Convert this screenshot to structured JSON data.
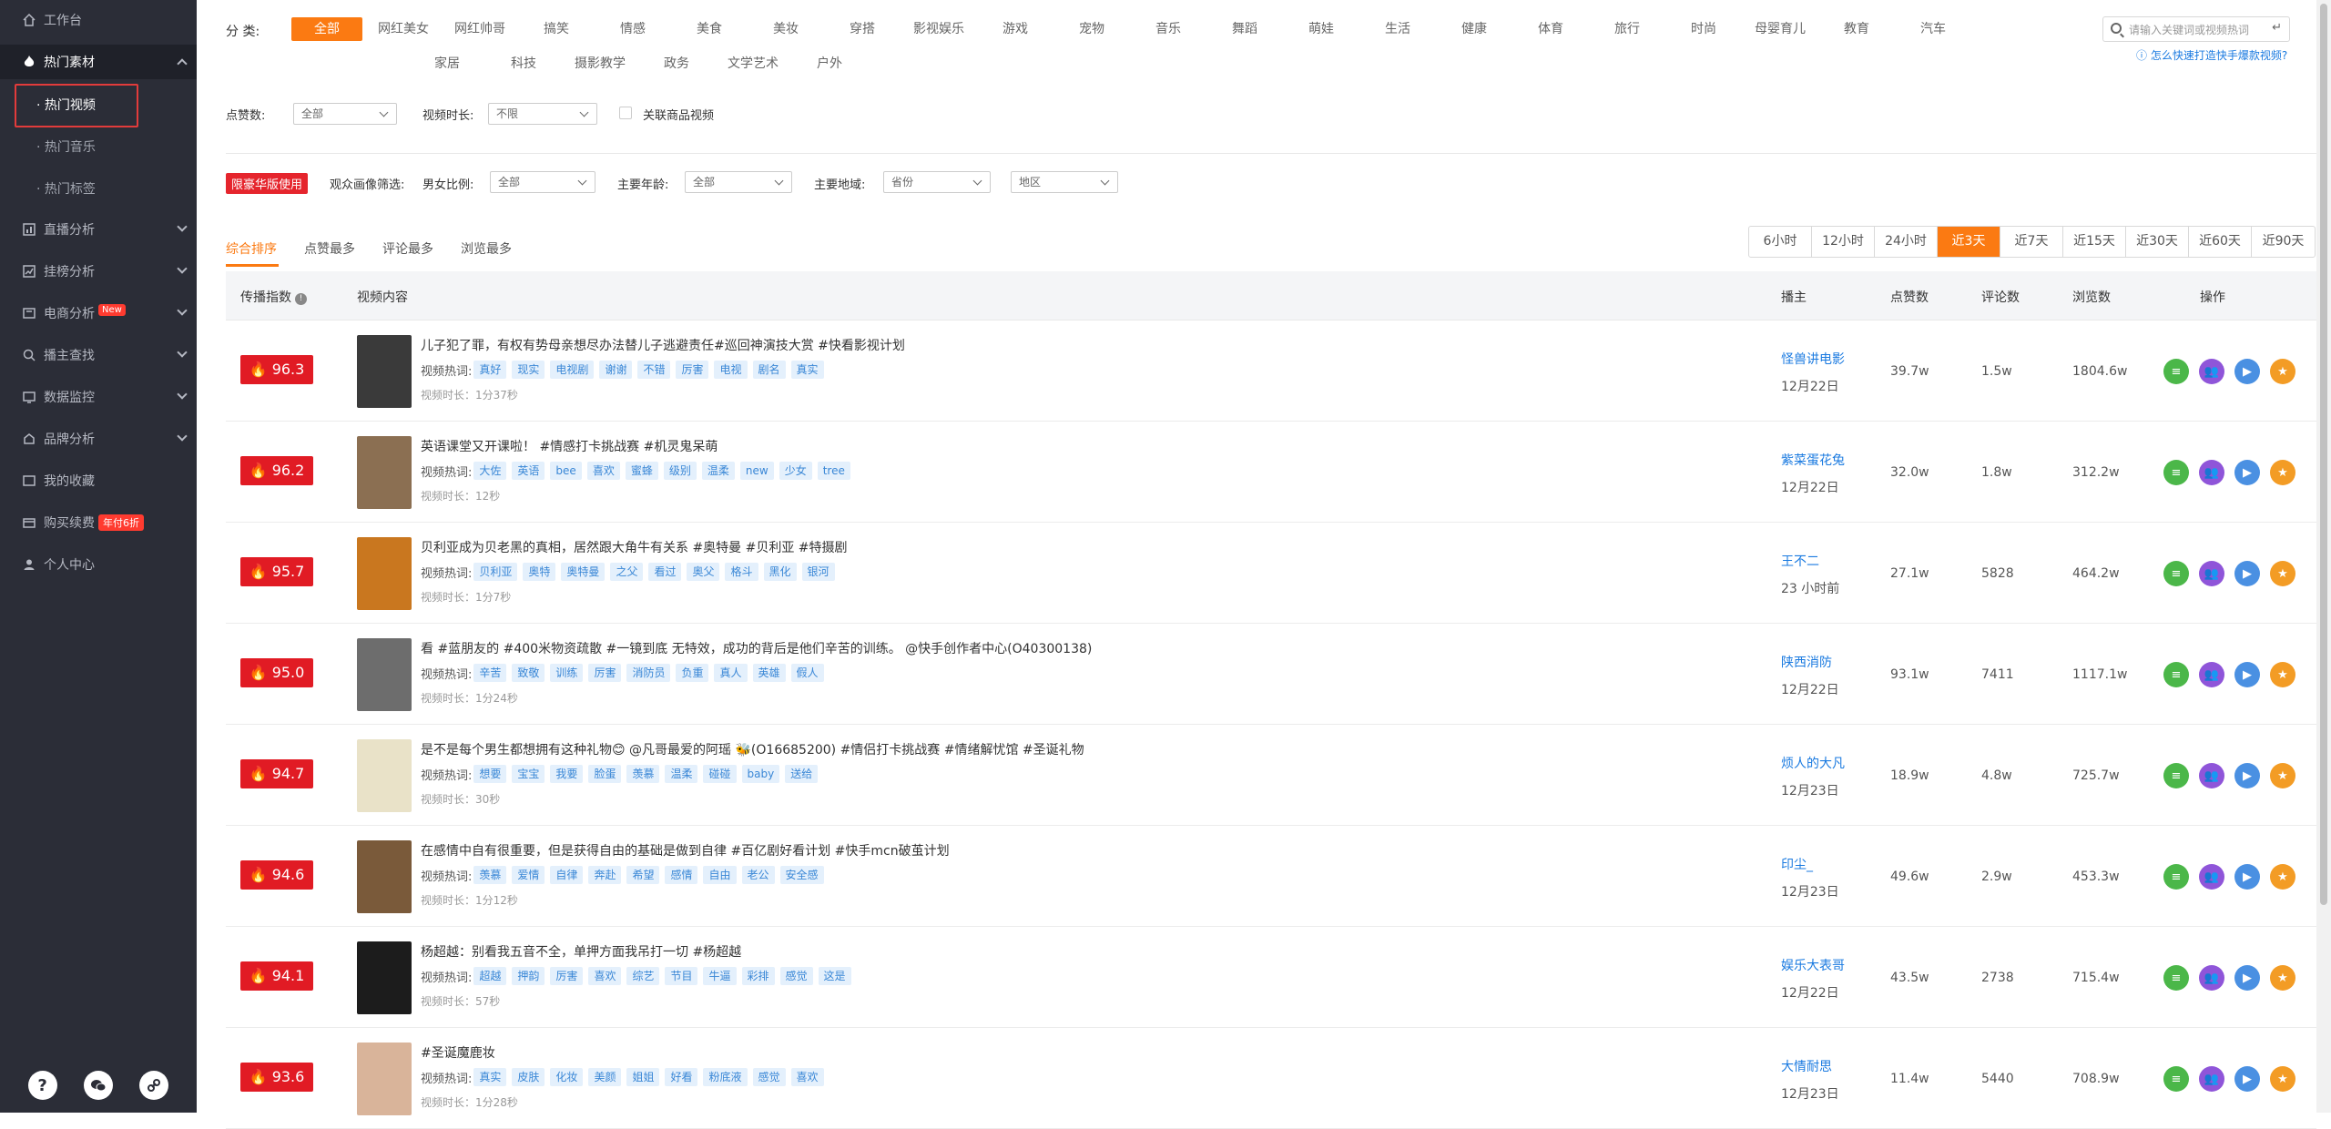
{
  "sidebar": {
    "items": [
      {
        "label": "工作台",
        "icon": "home-icon"
      },
      {
        "label": "热门素材",
        "icon": "fire-icon"
      },
      {
        "label": "直播分析",
        "icon": "bar-chart-icon"
      },
      {
        "label": "挂榜分析",
        "icon": "trend-icon"
      },
      {
        "label": "电商分析",
        "icon": "cart-icon",
        "badge": "New"
      },
      {
        "label": "播主查找",
        "icon": "search-icon"
      },
      {
        "label": "数据监控",
        "icon": "monitor-icon"
      },
      {
        "label": "品牌分析",
        "icon": "brand-icon"
      },
      {
        "label": "我的收藏",
        "icon": "star-icon"
      },
      {
        "label": "购买续费",
        "icon": "wallet-icon",
        "badge": "年付6折"
      },
      {
        "label": "个人中心",
        "icon": "user-icon"
      }
    ],
    "sub": [
      "· 热门视频",
      "· 热门音乐",
      "· 热门标签"
    ]
  },
  "filters": {
    "category_label": "分  类:",
    "categories_row1": [
      "全部",
      "网红美女",
      "网红帅哥",
      "搞笑",
      "情感",
      "美食",
      "美妆",
      "穿搭",
      "影视娱乐",
      "游戏",
      "宠物",
      "音乐",
      "舞蹈",
      "萌娃",
      "生活",
      "健康",
      "体育",
      "旅行",
      "时尚",
      "母婴育儿",
      "教育",
      "汽车"
    ],
    "categories_row2": [
      "家居",
      "科技",
      "摄影教学",
      "政务",
      "文学艺术",
      "户外"
    ],
    "search_placeholder": "请输入关键词或视频热词",
    "help": "怎么快速打造快手爆款视频?",
    "likes_label": "点赞数:",
    "likes_value": "全部",
    "duration_label": "视频时长:",
    "duration_value": "不限",
    "linked_label": "关联商品视频",
    "vip_tag": "限豪华版使用",
    "audience_label": "观众画像筛选:",
    "gender_label": "男女比例:",
    "gender_value": "全部",
    "age_label": "主要年龄:",
    "age_value": "全部",
    "region_label": "主要地域:",
    "province_value": "省份",
    "city_value": "地区"
  },
  "sort_tabs": [
    "综合排序",
    "点赞最多",
    "评论最多",
    "浏览最多"
  ],
  "time_buttons": [
    "6小时",
    "12小时",
    "24小时",
    "近3天",
    "近7天",
    "近15天",
    "近30天",
    "近60天",
    "近90天"
  ],
  "table_head": {
    "score": "传播指数",
    "content": "视频内容",
    "author": "播主",
    "likes": "点赞数",
    "comments": "评论数",
    "views": "浏览数",
    "actions": "操作"
  },
  "hot_label": "视频热词:",
  "rows": [
    {
      "score": "96.3",
      "title": "儿子犯了罪，有权有势母亲想尽办法替儿子逃避责任#巡回神演技大赏 #快看影视计划",
      "tags": [
        "真好",
        "现实",
        "电视剧",
        "谢谢",
        "不错",
        "厉害",
        "电视",
        "剧名",
        "真实"
      ],
      "dur": "视频时长：1分37秒",
      "author": "怪兽讲电影",
      "date": "12月22日",
      "likes": "39.7w",
      "comments": "1.5w",
      "views": "1804.6w",
      "thumb": "#3a3a3a"
    },
    {
      "score": "96.2",
      "title": "英语课堂又开课啦！ #情感打卡挑战赛 #机灵鬼呆萌",
      "tags": [
        "大佐",
        "英语",
        "bee",
        "喜欢",
        "蜜蜂",
        "级别",
        "温柔",
        "new",
        "少女",
        "tree"
      ],
      "dur": "视频时长：12秒",
      "author": "紫菜蛋花兔",
      "date": "12月22日",
      "likes": "32.0w",
      "comments": "1.8w",
      "views": "312.2w",
      "thumb": "#8b6f52"
    },
    {
      "score": "95.7",
      "title": "贝利亚成为贝老黑的真相，居然跟大角牛有关系 #奥特曼 #贝利亚 #特摄剧",
      "tags": [
        "贝利亚",
        "奥特",
        "奥特曼",
        "之父",
        "看过",
        "奥父",
        "格斗",
        "黑化",
        "银河"
      ],
      "dur": "视频时长：1分7秒",
      "author": "王不二",
      "date": "23 小时前",
      "likes": "27.1w",
      "comments": "5828",
      "views": "464.2w",
      "thumb": "#c9771f"
    },
    {
      "score": "95.0",
      "title": "看 #蓝朋友的 #400米物资疏散 #一镜到底 无特效，成功的背后是他们辛苦的训练。 @快手创作者中心(O40300138)",
      "tags": [
        "辛苦",
        "致敬",
        "训练",
        "厉害",
        "消防员",
        "负重",
        "真人",
        "英雄",
        "假人"
      ],
      "dur": "视频时长：1分24秒",
      "author": "陕西消防",
      "date": "12月22日",
      "likes": "93.1w",
      "comments": "7411",
      "views": "1117.1w",
      "thumb": "#6d6d6d"
    },
    {
      "score": "94.7",
      "title": "是不是每个男生都想拥有这种礼物😊 @凡哥最爱的阿瑶 🐝(O16685200) #情侣打卡挑战赛 #情绪解忧馆 #圣诞礼物",
      "tags": [
        "想要",
        "宝宝",
        "我要",
        "脸蛋",
        "羡慕",
        "温柔",
        "碰碰",
        "baby",
        "送给"
      ],
      "dur": "视频时长：30秒",
      "author": "烦人的大凡",
      "date": "12月23日",
      "likes": "18.9w",
      "comments": "4.8w",
      "views": "725.7w",
      "thumb": "#e9e2c8"
    },
    {
      "score": "94.6",
      "title": "在感情中自有很重要，但是获得自由的基础是做到自律 #百亿剧好看计划 #快手mcn破茧计划",
      "tags": [
        "羡慕",
        "爱情",
        "自律",
        "奔赴",
        "希望",
        "感情",
        "自由",
        "老公",
        "安全感"
      ],
      "dur": "视频时长：1分12秒",
      "author": "印尘_",
      "date": "12月23日",
      "likes": "49.6w",
      "comments": "2.9w",
      "views": "453.3w",
      "thumb": "#7a5a3a"
    },
    {
      "score": "94.1",
      "title": "杨超越：别看我五音不全，单押方面我吊打一切 #杨超越",
      "tags": [
        "超越",
        "押韵",
        "厉害",
        "喜欢",
        "综艺",
        "节目",
        "牛逼",
        "彩排",
        "感觉",
        "这是"
      ],
      "dur": "视频时长：57秒",
      "author": "娱乐大表哥",
      "date": "12月22日",
      "likes": "43.5w",
      "comments": "2738",
      "views": "715.4w",
      "thumb": "#1c1c1c"
    },
    {
      "score": "93.6",
      "title": "#圣诞魔鹿妆",
      "tags": [
        "真实",
        "皮肤",
        "化妆",
        "美颜",
        "姐姐",
        "好看",
        "粉底液",
        "感觉",
        "喜欢"
      ],
      "dur": "视频时长：1分28秒",
      "author": "大情耐思",
      "date": "12月23日",
      "likes": "11.4w",
      "comments": "5440",
      "views": "708.9w",
      "thumb": "#d9b49a"
    }
  ]
}
